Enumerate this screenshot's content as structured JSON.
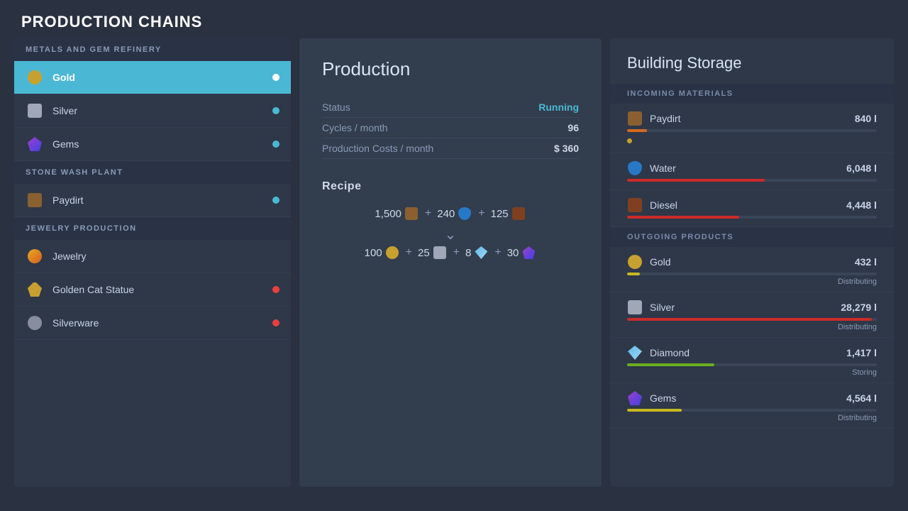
{
  "page": {
    "title": "PRODUCTION CHAINS"
  },
  "left_panel": {
    "sections": [
      {
        "header": "METALS AND GEM REFINERY",
        "items": [
          {
            "id": "gold",
            "label": "Gold",
            "icon": "gold",
            "dot": "white",
            "active": true
          },
          {
            "id": "silver",
            "label": "Silver",
            "icon": "silver",
            "dot": "blue",
            "active": false
          },
          {
            "id": "gems",
            "label": "Gems",
            "icon": "gems",
            "dot": "blue",
            "active": false
          }
        ]
      },
      {
        "header": "STONE WASH PLANT",
        "items": [
          {
            "id": "paydirt",
            "label": "Paydirt",
            "icon": "paydirt",
            "dot": "blue",
            "active": false
          }
        ]
      },
      {
        "header": "JEWELRY PRODUCTION",
        "items": [
          {
            "id": "jewelry",
            "label": "Jewelry",
            "icon": "jewelry",
            "dot": "none",
            "active": false
          },
          {
            "id": "golden-cat",
            "label": "Golden Cat Statue",
            "icon": "cat",
            "dot": "red",
            "active": false
          },
          {
            "id": "silverware",
            "label": "Silverware",
            "icon": "silverware",
            "dot": "red",
            "active": false
          }
        ]
      }
    ]
  },
  "middle_panel": {
    "title": "Production",
    "stats": [
      {
        "label": "Status",
        "value": "Running",
        "highlight": true
      },
      {
        "label": "Cycles / month",
        "value": "96"
      },
      {
        "label": "Production Costs / month",
        "value": "$ 360"
      }
    ],
    "recipe_title": "Recipe",
    "recipe_inputs": "1,500 🟤 + 240 💧 + 125 ⛽",
    "recipe_outputs": "100 🥇 + 25 🥈 + 8 💎 + 30 💎",
    "recipe_inputs_text": "1,500 + 240 + 125",
    "recipe_outputs_text": "100 + 25 + 8 + 30"
  },
  "right_panel": {
    "title": "Building Storage",
    "incoming_header": "INCOMING MATERIALS",
    "outgoing_header": "OUTGOING PRODUCTS",
    "incoming": [
      {
        "id": "paydirt",
        "label": "Paydirt",
        "amount": "840 l",
        "bar_pct": 8,
        "bar_color": "bar-orange",
        "status": ""
      },
      {
        "id": "water",
        "label": "Water",
        "amount": "6,048 l",
        "bar_pct": 55,
        "bar_color": "bar-red",
        "status": ""
      },
      {
        "id": "diesel",
        "label": "Diesel",
        "amount": "4,448 l",
        "bar_pct": 45,
        "bar_color": "bar-red",
        "status": ""
      }
    ],
    "outgoing": [
      {
        "id": "gold",
        "label": "Gold",
        "amount": "432 l",
        "bar_pct": 5,
        "bar_color": "bar-yellow",
        "status": "Distributing"
      },
      {
        "id": "silver",
        "label": "Silver",
        "amount": "28,279 l",
        "bar_pct": 98,
        "bar_color": "bar-red",
        "status": "Distributing"
      },
      {
        "id": "diamond",
        "label": "Diamond",
        "amount": "1,417 l",
        "bar_pct": 35,
        "bar_color": "bar-green",
        "status": "Storing"
      },
      {
        "id": "gems",
        "label": "Gems",
        "amount": "4,564 l",
        "bar_pct": 22,
        "bar_color": "bar-yellow",
        "status": "Distributing"
      }
    ]
  }
}
